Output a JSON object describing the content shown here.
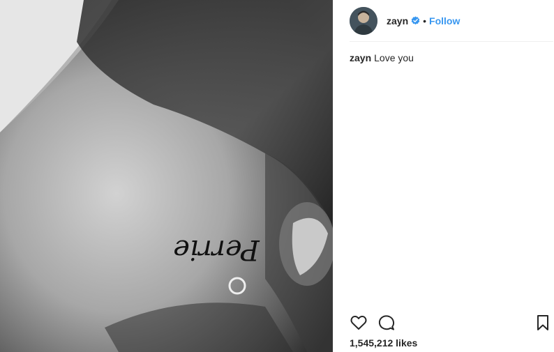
{
  "post": {
    "author": "zayn",
    "follow_label": "Follow",
    "separator": "•",
    "caption_user": "zayn",
    "caption_text": "Love you",
    "likes": "1,545,212 likes",
    "photo_tattoo_text": "Perrie"
  },
  "icons": {
    "verified": "verified-badge-icon",
    "like": "heart-icon",
    "comment": "comment-icon",
    "save": "bookmark-icon"
  },
  "colors": {
    "accent": "#3897f0",
    "text": "#262626",
    "divider": "#efefef"
  }
}
